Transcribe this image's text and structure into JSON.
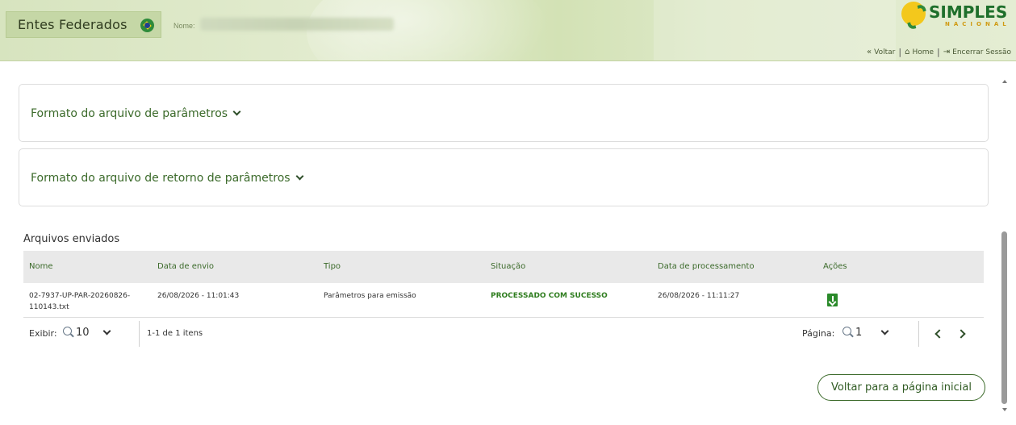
{
  "header": {
    "app_title": "Entes Federados",
    "nome_label": "Nome:",
    "logo_word": "SIMPLES",
    "logo_sub": "NACIONAL",
    "nav": {
      "voltar": "Voltar",
      "home": "Home",
      "encerrar": "Encerrar Sessão"
    }
  },
  "accordions": [
    {
      "title": "Formato do arquivo de parâmetros"
    },
    {
      "title": "Formato do arquivo de retorno de parâmetros"
    }
  ],
  "files": {
    "title": "Arquivos enviados",
    "columns": [
      "Nome",
      "Data de envio",
      "Tipo",
      "Situação",
      "Data de processamento",
      "Ações"
    ],
    "rows": [
      {
        "nome_line1": "02-7937-UP-PAR-20260826-",
        "nome_line2": "110143.txt",
        "data_envio": "26/08/2026 - 11:01:43",
        "tipo": "Parâmetros para emissão",
        "situacao": "PROCESSADO COM SUCESSO",
        "data_processamento": "26/08/2026 - 11:11:27",
        "acao_icon": "download-file-icon"
      }
    ],
    "pager": {
      "exibir_label": "Exibir:",
      "exibir_value": "10",
      "info": "1-1 de 1 itens",
      "pagina_label": "Página:",
      "pagina_value": "1"
    }
  },
  "back_button": "Voltar para a página inicial",
  "colors": {
    "accent_green": "#3b6a2a",
    "status_green": "#2f7d1f",
    "header_bg": "#d7e4bf"
  }
}
